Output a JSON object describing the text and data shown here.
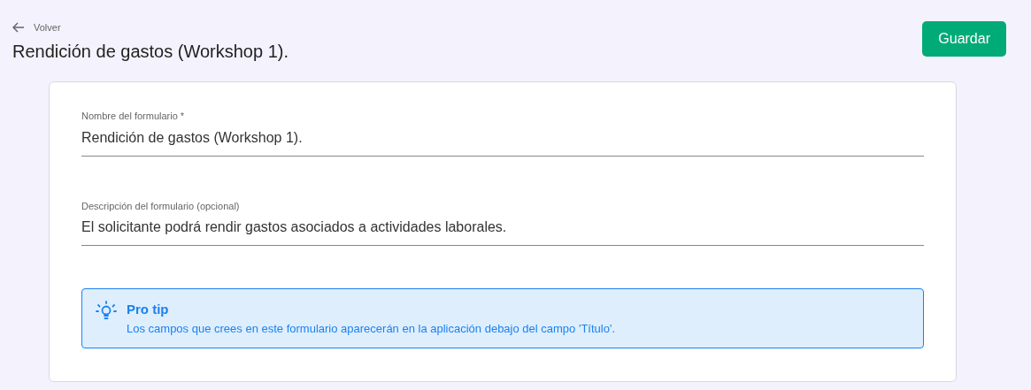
{
  "back_link": {
    "label": "Volver"
  },
  "page_title": "Rendición de gastos (Workshop 1).",
  "save_button": {
    "label": "Guardar"
  },
  "form": {
    "fields": [
      {
        "label": "Nombre del formulario *",
        "value": "Rendición de gastos (Workshop 1)."
      },
      {
        "label": "Descripción del formulario (opcional)",
        "value": "El solicitante podrá rendir gastos asociados a actividades laborales."
      }
    ],
    "tip": {
      "title": "Pro tip",
      "text": "Los campos que crees en este formulario aparecerán en la aplicación debajo del campo 'Título'."
    }
  }
}
